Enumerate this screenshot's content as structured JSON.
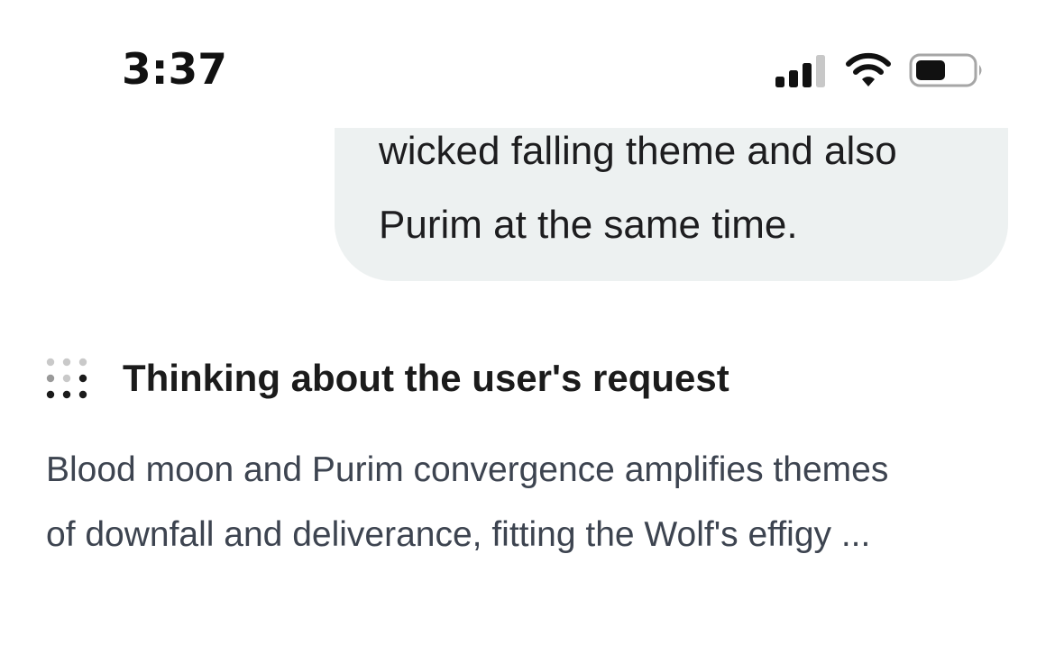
{
  "status_bar": {
    "time": "3:37",
    "signal_icon": "cellular-signal-icon",
    "wifi_icon": "wifi-icon",
    "battery_icon": "battery-icon"
  },
  "message": {
    "lines": [
      "wicked falling theme and also",
      "Purim at the same time."
    ]
  },
  "thinking": {
    "icon": "thinking-dots-icon",
    "title": "Thinking about the user's request",
    "summary_lines": [
      "Blood moon and Purim convergence amplifies themes",
      "of downfall and deliverance, fitting the Wolf's effigy ..."
    ]
  },
  "colors": {
    "bubble_background": "#edf1f1",
    "summary_text": "#3d4450",
    "primary_text": "#1b1b1b"
  }
}
